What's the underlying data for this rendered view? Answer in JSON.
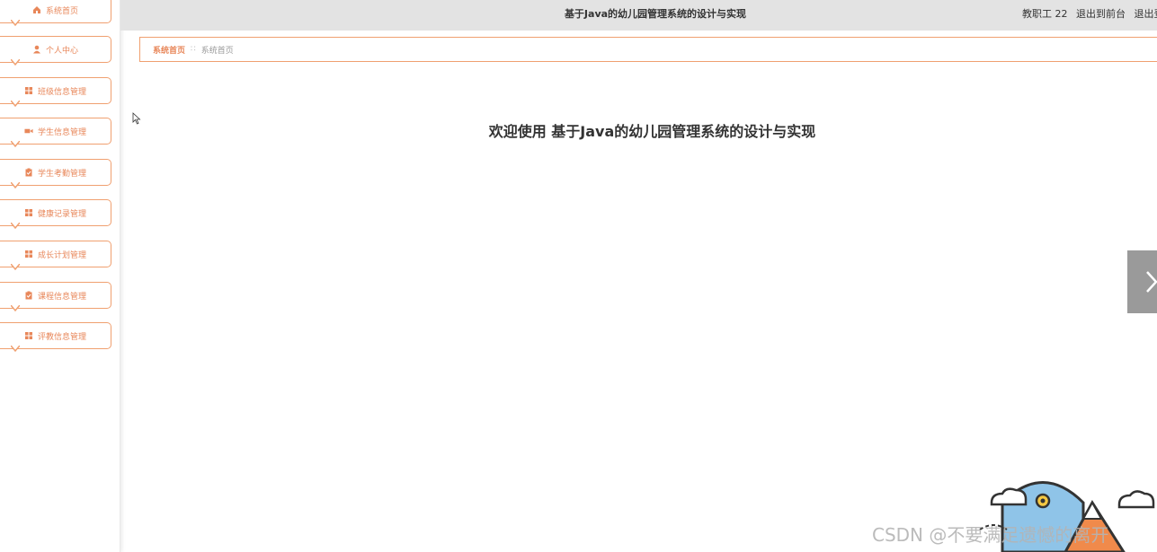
{
  "sidebar": {
    "items": [
      {
        "label": "系统首页",
        "icon": "home-icon"
      },
      {
        "label": "个人中心",
        "icon": "user-icon"
      },
      {
        "label": "班级信息管理",
        "icon": "grid-icon"
      },
      {
        "label": "学生信息管理",
        "icon": "video-icon"
      },
      {
        "label": "学生考勤管理",
        "icon": "clipboard-icon"
      },
      {
        "label": "健康记录管理",
        "icon": "grid-icon"
      },
      {
        "label": "成长计划管理",
        "icon": "grid-icon"
      },
      {
        "label": "课程信息管理",
        "icon": "clipboard-icon"
      },
      {
        "label": "评教信息管理",
        "icon": "grid-icon"
      }
    ]
  },
  "header": {
    "title": "基于Java的幼儿园管理系统的设计与实现",
    "user": "教职工 22",
    "back_to_front": "退出到前台",
    "logout": "退出登录"
  },
  "breadcrumb": {
    "root": "系统首页",
    "separator": "∷",
    "current": "系统首页"
  },
  "main": {
    "welcome": "欢迎使用 基于Java的幼儿园管理系统的设计与实现"
  },
  "watermark": "CSDN @不要满足遗憾的离开",
  "colors": {
    "accent": "#e8875a",
    "border": "#f0a070",
    "topbar": "#e3e3e3"
  }
}
